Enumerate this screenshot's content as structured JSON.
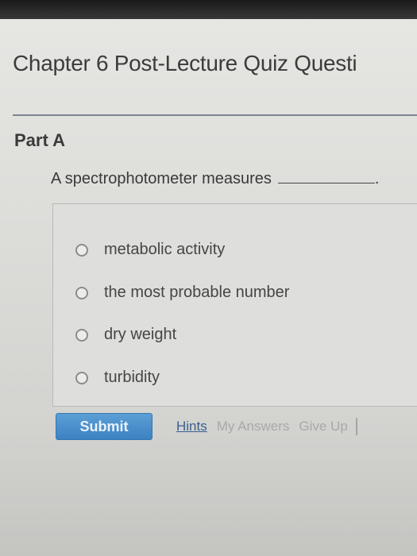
{
  "quiz": {
    "title": "Chapter 6 Post-Lecture Quiz Questi",
    "part_label": "Part A",
    "question": "A spectrophotometer measures",
    "question_suffix": ".",
    "options": [
      {
        "label": "metabolic activity",
        "selected": false
      },
      {
        "label": "the most probable number",
        "selected": false
      },
      {
        "label": "dry weight",
        "selected": false
      },
      {
        "label": "turbidity",
        "selected": false
      }
    ]
  },
  "actions": {
    "submit_label": "Submit",
    "hints_label": "Hints",
    "my_answers_label": "My Answers",
    "give_up_label": "Give Up"
  },
  "colors": {
    "submit_button": "#3c82c2",
    "hints_link": "#3a5f8f",
    "disabled_link": "#a9a9a7"
  }
}
